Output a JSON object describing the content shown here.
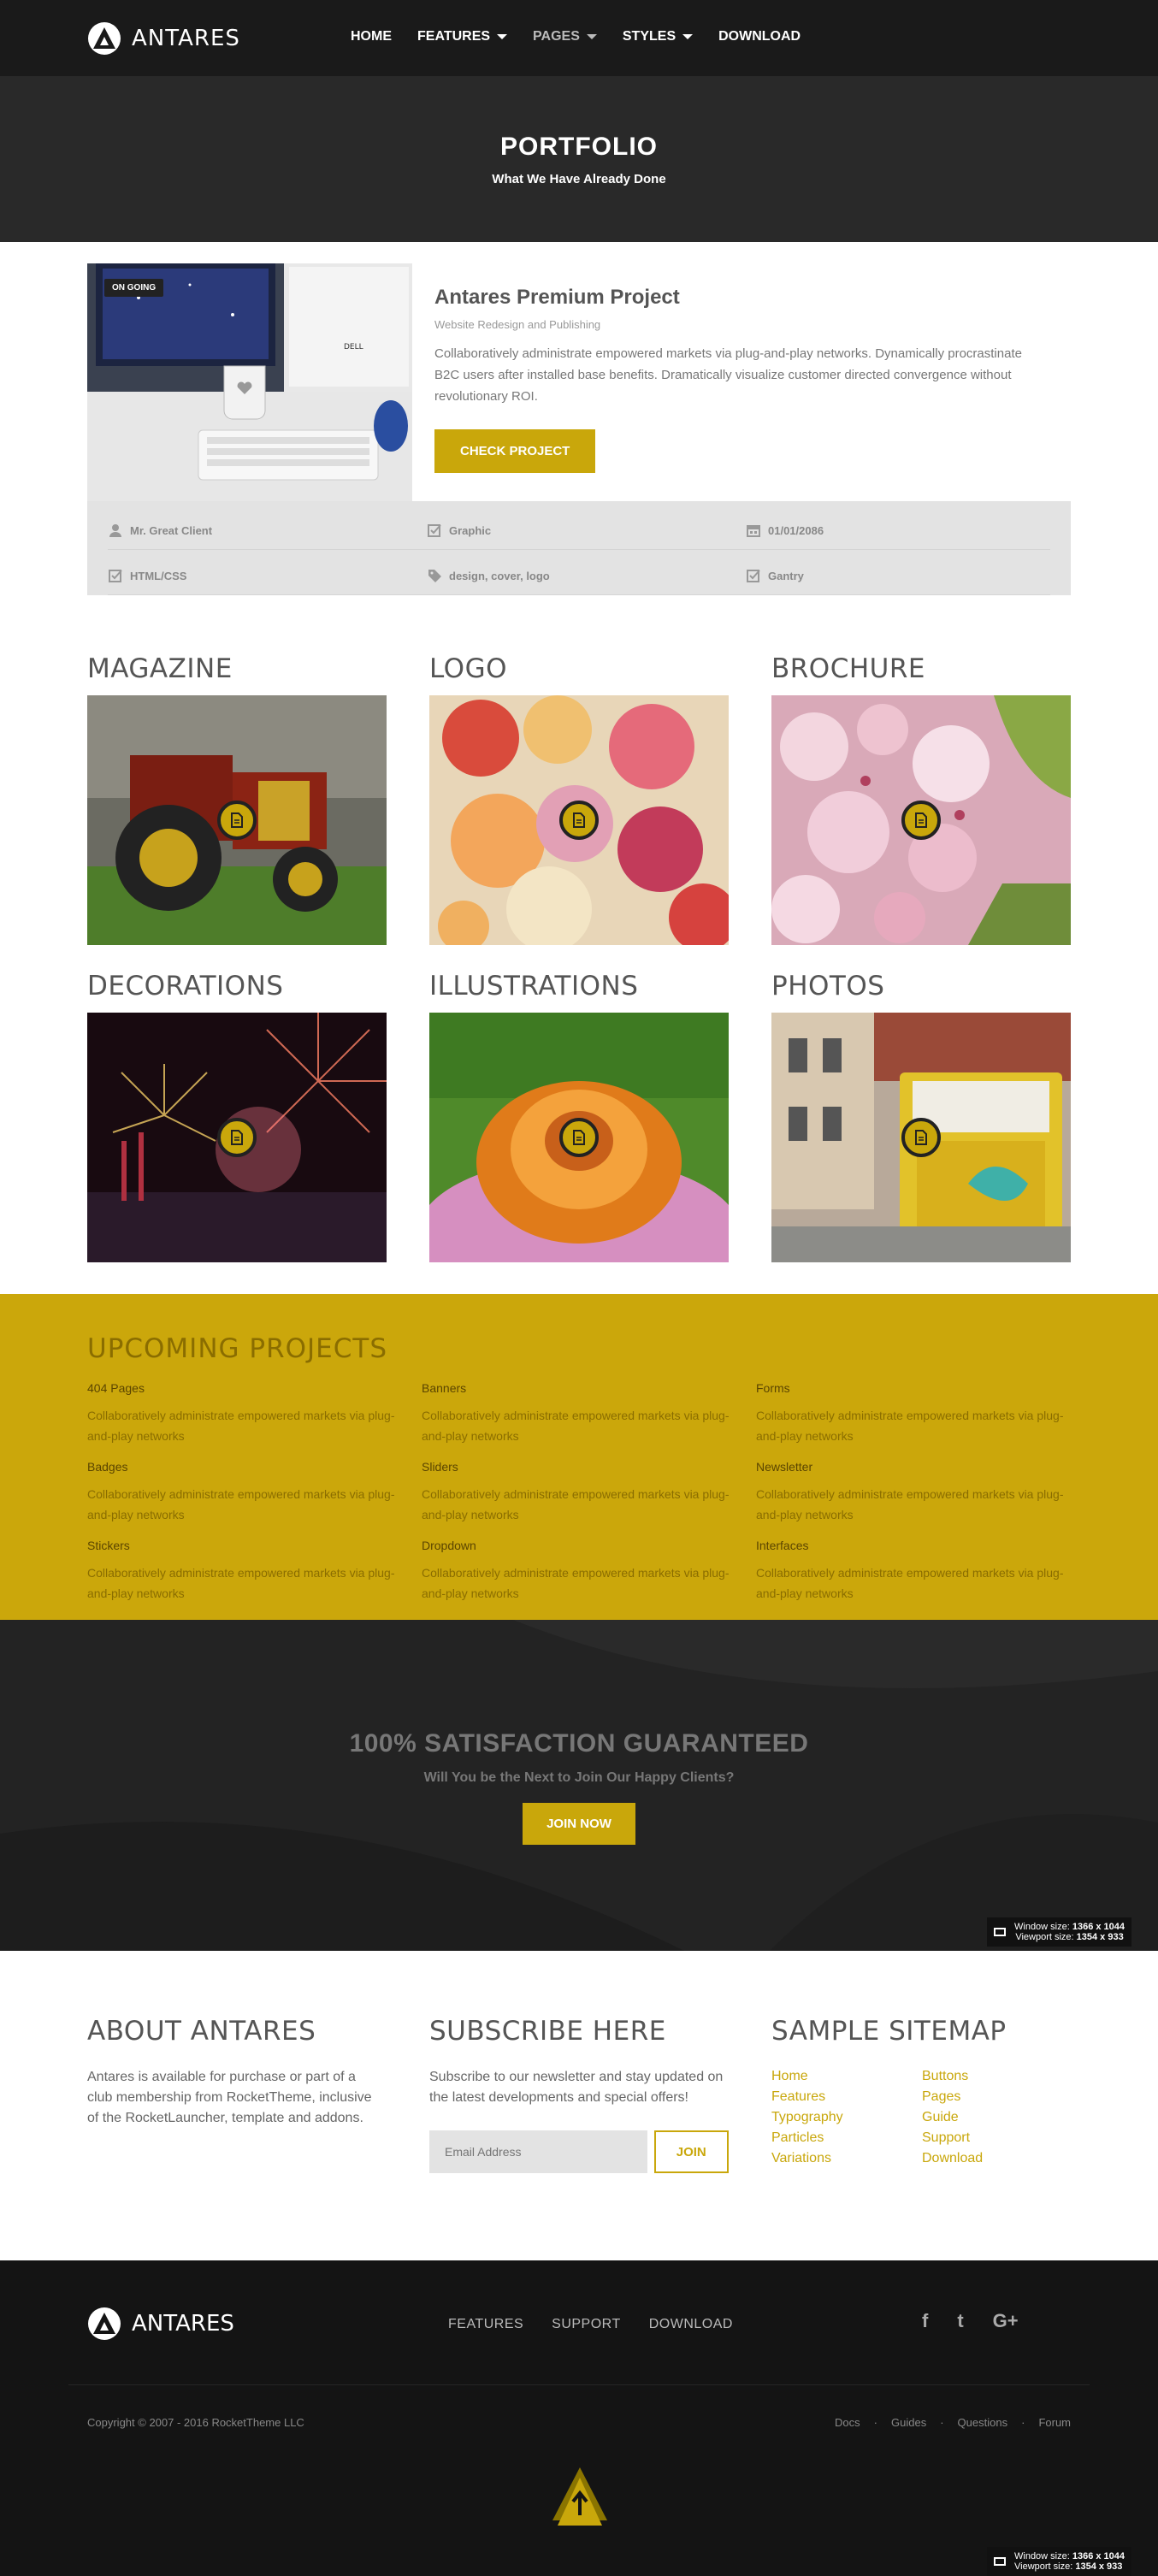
{
  "header": {
    "brand": "ANTARES",
    "nav": [
      {
        "label": "HOME"
      },
      {
        "label": "FEATURES"
      },
      {
        "label": "PAGES"
      },
      {
        "label": "STYLES"
      },
      {
        "label": "DOWNLOAD"
      }
    ]
  },
  "hero": {
    "title": "PORTFOLIO",
    "subtitle": "What We Have Already Done"
  },
  "featured": {
    "badge": "ON GOING",
    "monitor_brand": "DELL",
    "title": "Antares Premium Project",
    "subtitle": "Website Redesign and Publishing",
    "description": "Collaboratively administrate empowered markets via plug-and-play networks. Dynamically procrastinate B2C users after installed base benefits. Dramatically visualize customer directed convergence without revolutionary ROI.",
    "button": "CHECK PROJECT",
    "meta": [
      {
        "icon": "user-icon",
        "text": "Mr. Great Client"
      },
      {
        "icon": "checkbox-icon",
        "text": "Graphic"
      },
      {
        "icon": "calendar-icon",
        "text": "01/01/2086"
      },
      {
        "icon": "checkbox-icon",
        "text": "HTML/CSS"
      },
      {
        "icon": "tag-icon",
        "text": "design, cover, logo"
      },
      {
        "icon": "checkbox-icon",
        "text": "Gantry"
      }
    ]
  },
  "categories": [
    {
      "title": "MAGAZINE",
      "image": "tractor"
    },
    {
      "title": "LOGO",
      "image": "candies"
    },
    {
      "title": "BROCHURE",
      "image": "cherry-blossoms"
    },
    {
      "title": "DECORATIONS",
      "image": "fireworks"
    },
    {
      "title": "ILLUSTRATIONS",
      "image": "coneflower"
    },
    {
      "title": "PHOTOS",
      "image": "tram"
    }
  ],
  "upcoming": {
    "title": "UPCOMING PROJECTS",
    "items": [
      {
        "name": "404 Pages",
        "desc": "Collaboratively administrate empowered markets via plug-and-play networks"
      },
      {
        "name": "Banners",
        "desc": "Collaboratively administrate empowered markets via plug-and-play networks"
      },
      {
        "name": "Forms",
        "desc": "Collaboratively administrate empowered markets via plug-and-play networks"
      },
      {
        "name": "Badges",
        "desc": "Collaboratively administrate empowered markets via plug-and-play networks"
      },
      {
        "name": "Sliders",
        "desc": "Collaboratively administrate empowered markets via plug-and-play networks"
      },
      {
        "name": "Newsletter",
        "desc": "Collaboratively administrate empowered markets via plug-and-play networks"
      },
      {
        "name": "Stickers",
        "desc": "Collaboratively administrate empowered markets via plug-and-play networks"
      },
      {
        "name": "Dropdown",
        "desc": "Collaboratively administrate empowered markets via plug-and-play networks"
      },
      {
        "name": "Interfaces",
        "desc": "Collaboratively administrate empowered markets via plug-and-play networks"
      }
    ]
  },
  "guarantee": {
    "title": "100% SATISFACTION GUARANTEED",
    "subtitle": "Will You be the Next to Join Our Happy Clients?",
    "button": "JOIN NOW"
  },
  "size_overlay": {
    "window_label": "Window size:",
    "window_value": "1366 x 1044",
    "viewport_label": "Viewport size:",
    "viewport_value": "1354 x 933"
  },
  "about": {
    "title": "ABOUT ANTARES",
    "text": "Antares is available for purchase or part of a club membership from RocketTheme, inclusive of the RocketLauncher, template and addons."
  },
  "subscribe": {
    "title": "SUBSCRIBE HERE",
    "text": "Subscribe to our newsletter and stay updated on the latest developments and special offers!",
    "placeholder": "Email Address",
    "button": "JOIN"
  },
  "sitemap": {
    "title": "SAMPLE SITEMAP",
    "links": [
      "Home",
      "Buttons",
      "Features",
      "Pages",
      "Typography",
      "Guide",
      "Particles",
      "Support",
      "Variations",
      "Download"
    ]
  },
  "footer": {
    "brand": "ANTARES",
    "links": [
      "FEATURES",
      "SUPPORT",
      "DOWNLOAD"
    ],
    "social": [
      {
        "icon": "facebook-icon",
        "glyph": "f"
      },
      {
        "icon": "twitter-icon",
        "glyph": "t"
      },
      {
        "icon": "google-plus-icon",
        "glyph": "G+"
      }
    ],
    "copyright": "Copyright © 2007 - 2016 RocketTheme LLC",
    "bottom_links": [
      "Docs",
      "Guides",
      "Questions",
      "Forum"
    ],
    "separator": "·"
  },
  "colors": {
    "accent": "#c9a70b",
    "dark": "#1a1a1a"
  }
}
